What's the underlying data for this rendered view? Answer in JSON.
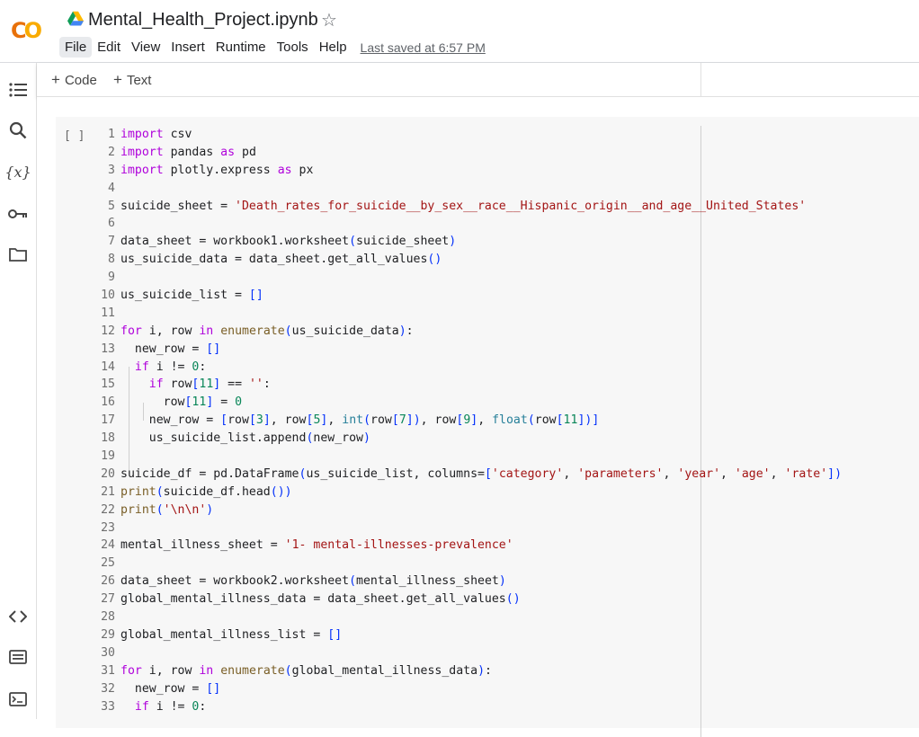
{
  "header": {
    "logo_text_a": "C",
    "logo_text_b": "O",
    "title": "Mental_Health_Project.ipynb",
    "star_icon": "star-outline-icon",
    "menu": [
      "File",
      "Edit",
      "View",
      "Insert",
      "Runtime",
      "Tools",
      "Help"
    ],
    "last_saved": "Last saved at 6:57 PM"
  },
  "sidebar": {
    "icons": [
      "toc-icon",
      "search-icon",
      "variables-icon",
      "key-icon",
      "folder-icon",
      "code-snippets-icon",
      "command-palette-icon",
      "terminal-icon"
    ],
    "variables_glyph": "{x}"
  },
  "toolbar": {
    "add_code": "Code",
    "add_text": "Text",
    "plus": "+"
  },
  "cell": {
    "run_indicator": "[ ]",
    "lines": [
      {
        "n": "1",
        "tokens": [
          [
            "kw",
            "import"
          ],
          [
            "op",
            " csv"
          ]
        ]
      },
      {
        "n": "2",
        "tokens": [
          [
            "kw",
            "import"
          ],
          [
            "op",
            " pandas "
          ],
          [
            "kw",
            "as"
          ],
          [
            "op",
            " pd"
          ]
        ]
      },
      {
        "n": "3",
        "tokens": [
          [
            "kw",
            "import"
          ],
          [
            "op",
            " plotly.express "
          ],
          [
            "kw",
            "as"
          ],
          [
            "op",
            " px"
          ]
        ]
      },
      {
        "n": "4",
        "tokens": []
      },
      {
        "n": "5",
        "tokens": [
          [
            "op",
            "suicide_sheet = "
          ],
          [
            "str",
            "'Death_rates_for_suicide__by_sex__race__Hispanic_origin__and_age__United_States'"
          ]
        ]
      },
      {
        "n": "6",
        "tokens": []
      },
      {
        "n": "7",
        "tokens": [
          [
            "op",
            "data_sheet = workbook1.worksheet"
          ],
          [
            "br",
            "("
          ],
          [
            "op",
            "suicide_sheet"
          ],
          [
            "br",
            ")"
          ]
        ]
      },
      {
        "n": "8",
        "tokens": [
          [
            "op",
            "us_suicide_data = data_sheet.get_all_values"
          ],
          [
            "br",
            "()"
          ]
        ]
      },
      {
        "n": "9",
        "tokens": []
      },
      {
        "n": "10",
        "tokens": [
          [
            "op",
            "us_suicide_list = "
          ],
          [
            "br",
            "[]"
          ]
        ]
      },
      {
        "n": "11",
        "tokens": []
      },
      {
        "n": "12",
        "tokens": [
          [
            "kw",
            "for"
          ],
          [
            "op",
            " i, row "
          ],
          [
            "kw",
            "in"
          ],
          [
            "op",
            " "
          ],
          [
            "fn",
            "enumerate"
          ],
          [
            "br",
            "("
          ],
          [
            "op",
            "us_suicide_data"
          ],
          [
            "br",
            ")"
          ],
          [
            "op",
            ":"
          ]
        ]
      },
      {
        "n": "13",
        "tokens": [
          [
            "op",
            "  new_row = "
          ],
          [
            "br",
            "[]"
          ]
        ]
      },
      {
        "n": "14",
        "tokens": [
          [
            "op",
            "  "
          ],
          [
            "kw",
            "if"
          ],
          [
            "op",
            " i != "
          ],
          [
            "num",
            "0"
          ],
          [
            "op",
            ":"
          ]
        ]
      },
      {
        "n": "15",
        "tokens": [
          [
            "op",
            "    "
          ],
          [
            "kw",
            "if"
          ],
          [
            "op",
            " row"
          ],
          [
            "br",
            "["
          ],
          [
            "num",
            "11"
          ],
          [
            "br",
            "]"
          ],
          [
            "op",
            " == "
          ],
          [
            "str",
            "''"
          ],
          [
            "op",
            ":"
          ]
        ]
      },
      {
        "n": "16",
        "tokens": [
          [
            "op",
            "      row"
          ],
          [
            "br",
            "["
          ],
          [
            "num",
            "11"
          ],
          [
            "br",
            "]"
          ],
          [
            "op",
            " = "
          ],
          [
            "num",
            "0"
          ]
        ]
      },
      {
        "n": "17",
        "tokens": [
          [
            "op",
            "    new_row = "
          ],
          [
            "br",
            "["
          ],
          [
            "op",
            "row"
          ],
          [
            "br",
            "["
          ],
          [
            "num",
            "3"
          ],
          [
            "br",
            "]"
          ],
          [
            "op",
            ", row"
          ],
          [
            "br",
            "["
          ],
          [
            "num",
            "5"
          ],
          [
            "br",
            "]"
          ],
          [
            "op",
            ", "
          ],
          [
            "bi",
            "int"
          ],
          [
            "br",
            "("
          ],
          [
            "op",
            "row"
          ],
          [
            "br",
            "["
          ],
          [
            "num",
            "7"
          ],
          [
            "br",
            "])"
          ],
          [
            "op",
            ", row"
          ],
          [
            "br",
            "["
          ],
          [
            "num",
            "9"
          ],
          [
            "br",
            "]"
          ],
          [
            "op",
            ", "
          ],
          [
            "bi",
            "float"
          ],
          [
            "br",
            "("
          ],
          [
            "op",
            "row"
          ],
          [
            "br",
            "["
          ],
          [
            "num",
            "11"
          ],
          [
            "br",
            "])]"
          ]
        ]
      },
      {
        "n": "18",
        "tokens": [
          [
            "op",
            "    us_suicide_list.append"
          ],
          [
            "br",
            "("
          ],
          [
            "op",
            "new_row"
          ],
          [
            "br",
            ")"
          ]
        ]
      },
      {
        "n": "19",
        "tokens": []
      },
      {
        "n": "20",
        "tokens": [
          [
            "op",
            "suicide_df = pd.DataFrame"
          ],
          [
            "br",
            "("
          ],
          [
            "op",
            "us_suicide_list, columns="
          ],
          [
            "br",
            "["
          ],
          [
            "str",
            "'category'"
          ],
          [
            "op",
            ", "
          ],
          [
            "str",
            "'parameters'"
          ],
          [
            "op",
            ", "
          ],
          [
            "str",
            "'year'"
          ],
          [
            "op",
            ", "
          ],
          [
            "str",
            "'age'"
          ],
          [
            "op",
            ", "
          ],
          [
            "str",
            "'rate'"
          ],
          [
            "br",
            "])"
          ]
        ]
      },
      {
        "n": "21",
        "tokens": [
          [
            "fn",
            "print"
          ],
          [
            "br",
            "("
          ],
          [
            "op",
            "suicide_df.head"
          ],
          [
            "br",
            "())"
          ]
        ]
      },
      {
        "n": "22",
        "tokens": [
          [
            "fn",
            "print"
          ],
          [
            "br",
            "("
          ],
          [
            "str",
            "'\\n\\n'"
          ],
          [
            "br",
            ")"
          ]
        ]
      },
      {
        "n": "23",
        "tokens": []
      },
      {
        "n": "24",
        "tokens": [
          [
            "op",
            "mental_illness_sheet = "
          ],
          [
            "str",
            "'1- mental-illnesses-prevalence'"
          ]
        ]
      },
      {
        "n": "25",
        "tokens": []
      },
      {
        "n": "26",
        "tokens": [
          [
            "op",
            "data_sheet = workbook2.worksheet"
          ],
          [
            "br",
            "("
          ],
          [
            "op",
            "mental_illness_sheet"
          ],
          [
            "br",
            ")"
          ]
        ]
      },
      {
        "n": "27",
        "tokens": [
          [
            "op",
            "global_mental_illness_data = data_sheet.get_all_values"
          ],
          [
            "br",
            "()"
          ]
        ]
      },
      {
        "n": "28",
        "tokens": []
      },
      {
        "n": "29",
        "tokens": [
          [
            "op",
            "global_mental_illness_list = "
          ],
          [
            "br",
            "[]"
          ]
        ]
      },
      {
        "n": "30",
        "tokens": []
      },
      {
        "n": "31",
        "tokens": [
          [
            "kw",
            "for"
          ],
          [
            "op",
            " i, row "
          ],
          [
            "kw",
            "in"
          ],
          [
            "op",
            " "
          ],
          [
            "fn",
            "enumerate"
          ],
          [
            "br",
            "("
          ],
          [
            "op",
            "global_mental_illness_data"
          ],
          [
            "br",
            ")"
          ],
          [
            "op",
            ":"
          ]
        ]
      },
      {
        "n": "32",
        "tokens": [
          [
            "op",
            "  new_row = "
          ],
          [
            "br",
            "[]"
          ]
        ]
      },
      {
        "n": "33",
        "tokens": [
          [
            "op",
            "  "
          ],
          [
            "kw",
            "if"
          ],
          [
            "op",
            " i != "
          ],
          [
            "num",
            "0"
          ],
          [
            "op",
            ":"
          ]
        ]
      }
    ]
  }
}
